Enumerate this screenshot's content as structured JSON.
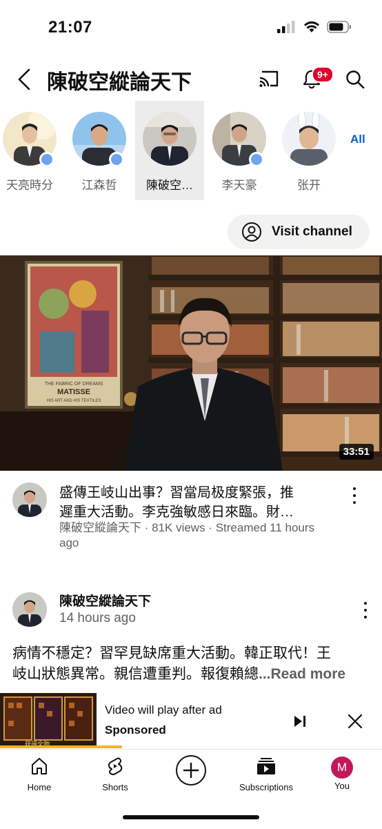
{
  "status_bar": {
    "time": "21:07"
  },
  "header": {
    "title": "陳破空縱論天下",
    "notification_badge": "9+"
  },
  "subscriptions": {
    "items": [
      {
        "name": "天亮時分",
        "has_new": true,
        "selected": false
      },
      {
        "name": "江森哲",
        "has_new": true,
        "selected": false
      },
      {
        "name": "陳破空…",
        "has_new": false,
        "selected": true
      },
      {
        "name": "李天豪",
        "has_new": true,
        "selected": false
      },
      {
        "name": "张开",
        "has_new": false,
        "selected": false
      }
    ],
    "all_label": "All"
  },
  "visit_channel": {
    "label": "Visit channel"
  },
  "video": {
    "title_line1": "盛傳王岐山出事？習當局极度緊張，推",
    "title_line2": "遲重大活動。李克強敏感日來臨。財…",
    "meta_line1": "陳破空縱論天下 · 81K views · Streamed 11 hours",
    "meta_line2": "ago",
    "duration": "33:51",
    "poster_text": {
      "line1": "THE FABRIC OF DREAMS",
      "line2": "MATISSE",
      "line3": "HIS ART AND HIS TEXTILES"
    }
  },
  "post": {
    "channel": "陳破空縱論天下",
    "time": "14 hours ago",
    "text_line1": "病情不穩定？習罕見缺席重大活動。韓正取代！王",
    "text_line2": "岐山狀態異常。親信遭重判。報復賴總",
    "read_more": "...Read more"
  },
  "ad": {
    "line1": "Video will play after ad",
    "line2": "Sponsored",
    "thumb_text": "获得全物",
    "progress": 0.32
  },
  "nav": {
    "home": "Home",
    "shorts": "Shorts",
    "subscriptions": "Subscriptions",
    "you": "You",
    "avatar_letter": "M"
  },
  "colors": {
    "accent_blue": "#065fd4",
    "badge_red": "#e1002d",
    "avatar_pink": "#c2185b",
    "ad_progress": "#f3b52a"
  }
}
